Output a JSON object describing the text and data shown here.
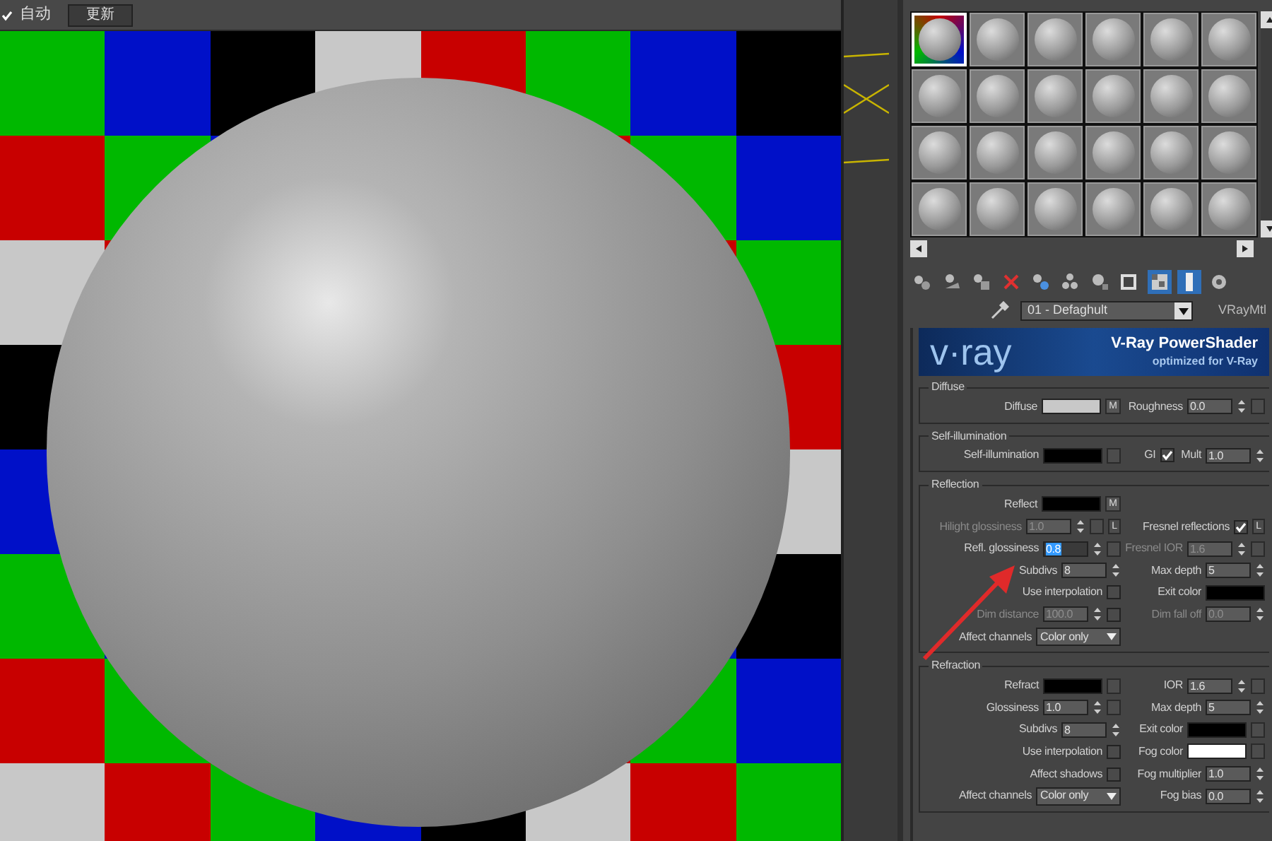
{
  "viewport_bar": {
    "auto": {
      "label": "自动",
      "checked": true
    },
    "update_button": "更新"
  },
  "slots": [
    {
      "selected": true
    },
    {
      "selected": false
    },
    {
      "selected": false
    },
    {
      "selected": false
    },
    {
      "selected": false
    },
    {
      "selected": false
    },
    {
      "selected": false
    },
    {
      "selected": false
    },
    {
      "selected": false
    },
    {
      "selected": false
    },
    {
      "selected": false
    },
    {
      "selected": false
    },
    {
      "selected": false
    },
    {
      "selected": false
    },
    {
      "selected": false
    },
    {
      "selected": false
    },
    {
      "selected": false
    },
    {
      "selected": false
    },
    {
      "selected": false
    },
    {
      "selected": false
    },
    {
      "selected": false
    },
    {
      "selected": false
    },
    {
      "selected": false
    },
    {
      "selected": false
    }
  ],
  "toolbar": [
    {
      "selected": false
    },
    {
      "selected": false
    },
    {
      "selected": false
    },
    {
      "selected": false
    },
    {
      "selected": false
    },
    {
      "selected": false
    },
    {
      "selected": false
    },
    {
      "selected": false
    },
    {
      "selected": true
    },
    {
      "selected": true
    },
    {
      "selected": false
    }
  ],
  "material": {
    "name": "01 - Defaghult",
    "type": "VRayMtl"
  },
  "banner": {
    "logo": "v·ray",
    "title": "V-Ray PowerShader",
    "subtitle": "optimized for V-Ray"
  },
  "sections": [
    {
      "title": "Diffuse",
      "rows": [
        {
          "left": {
            "kind": "color",
            "label": "Diffuse",
            "color": "#c8c8c8",
            "map": "M"
          },
          "right": [
            {
              "kind": "spinner",
              "label": "Roughness",
              "value": "0.0",
              "slot": true
            }
          ]
        }
      ]
    },
    {
      "title": "Self-illumination",
      "rows": [
        {
          "left": {
            "kind": "color",
            "label": "Self-illumination",
            "color": "#000000",
            "slot": true
          },
          "right": [
            {
              "kind": "checkbox",
              "label": "GI",
              "checked": true
            },
            {
              "kind": "spinner",
              "label": "Mult",
              "value": "1.0"
            }
          ]
        }
      ]
    },
    {
      "title": "Reflection",
      "rows": [
        {
          "left": {
            "kind": "color",
            "label": "Reflect",
            "color": "#000000",
            "map": "M"
          },
          "right": []
        },
        {
          "left": {
            "kind": "spinner",
            "label": "Hilight glossiness",
            "value": "1.0",
            "disabled": true,
            "slot": true,
            "lock": "L"
          },
          "right": [
            {
              "kind": "checkbox",
              "label": "Fresnel reflections",
              "checked": true,
              "lock": "L"
            }
          ]
        },
        {
          "left": {
            "kind": "spinner",
            "label": "Refl. glossiness",
            "value": "0.8",
            "selected": true,
            "slot": true
          },
          "right": [
            {
              "kind": "spinner",
              "label": "Fresnel IOR",
              "value": "1.6",
              "disabled": true,
              "slot": true
            }
          ]
        },
        {
          "left": {
            "kind": "spinner",
            "label": "Subdivs",
            "value": "8"
          },
          "right": [
            {
              "kind": "spinner",
              "label": "Max depth",
              "value": "5"
            }
          ]
        },
        {
          "left": {
            "kind": "checkbox",
            "label": "Use interpolation",
            "checked": false
          },
          "right": [
            {
              "kind": "color",
              "label": "Exit color",
              "color": "#000000"
            }
          ]
        },
        {
          "left": {
            "kind": "spinner",
            "label": "Dim distance",
            "value": "100.0",
            "disabled": true,
            "check": false
          },
          "right": [
            {
              "kind": "spinner",
              "label": "Dim fall off",
              "value": "0.0",
              "disabled": true
            }
          ]
        },
        {
          "left": {
            "kind": "dropdown",
            "label": "Affect channels",
            "value": "Color only"
          },
          "right": []
        }
      ]
    },
    {
      "title": "Refraction",
      "rows": [
        {
          "left": {
            "kind": "color",
            "label": "Refract",
            "color": "#000000",
            "slot": true
          },
          "right": [
            {
              "kind": "spinner",
              "label": "IOR",
              "value": "1.6",
              "slot": true
            }
          ]
        },
        {
          "left": {
            "kind": "spinner",
            "label": "Glossiness",
            "value": "1.0",
            "slot": true
          },
          "right": [
            {
              "kind": "spinner",
              "label": "Max depth",
              "value": "5"
            }
          ]
        },
        {
          "left": {
            "kind": "spinner",
            "label": "Subdivs",
            "value": "8"
          },
          "right": [
            {
              "kind": "color",
              "label": "Exit color",
              "color": "#000000",
              "slot": true
            }
          ]
        },
        {
          "left": {
            "kind": "checkbox",
            "label": "Use interpolation",
            "checked": false
          },
          "right": [
            {
              "kind": "color",
              "label": "Fog color",
              "color": "#ffffff",
              "slot": true
            }
          ]
        },
        {
          "left": {
            "kind": "checkbox",
            "label": "Affect shadows",
            "checked": false
          },
          "right": [
            {
              "kind": "spinner",
              "label": "Fog multiplier",
              "value": "1.0"
            }
          ]
        },
        {
          "left": {
            "kind": "dropdown",
            "label": "Affect channels",
            "value": "Color only"
          },
          "right": [
            {
              "kind": "spinner",
              "label": "Fog bias",
              "value": "0.0"
            }
          ]
        }
      ]
    }
  ]
}
